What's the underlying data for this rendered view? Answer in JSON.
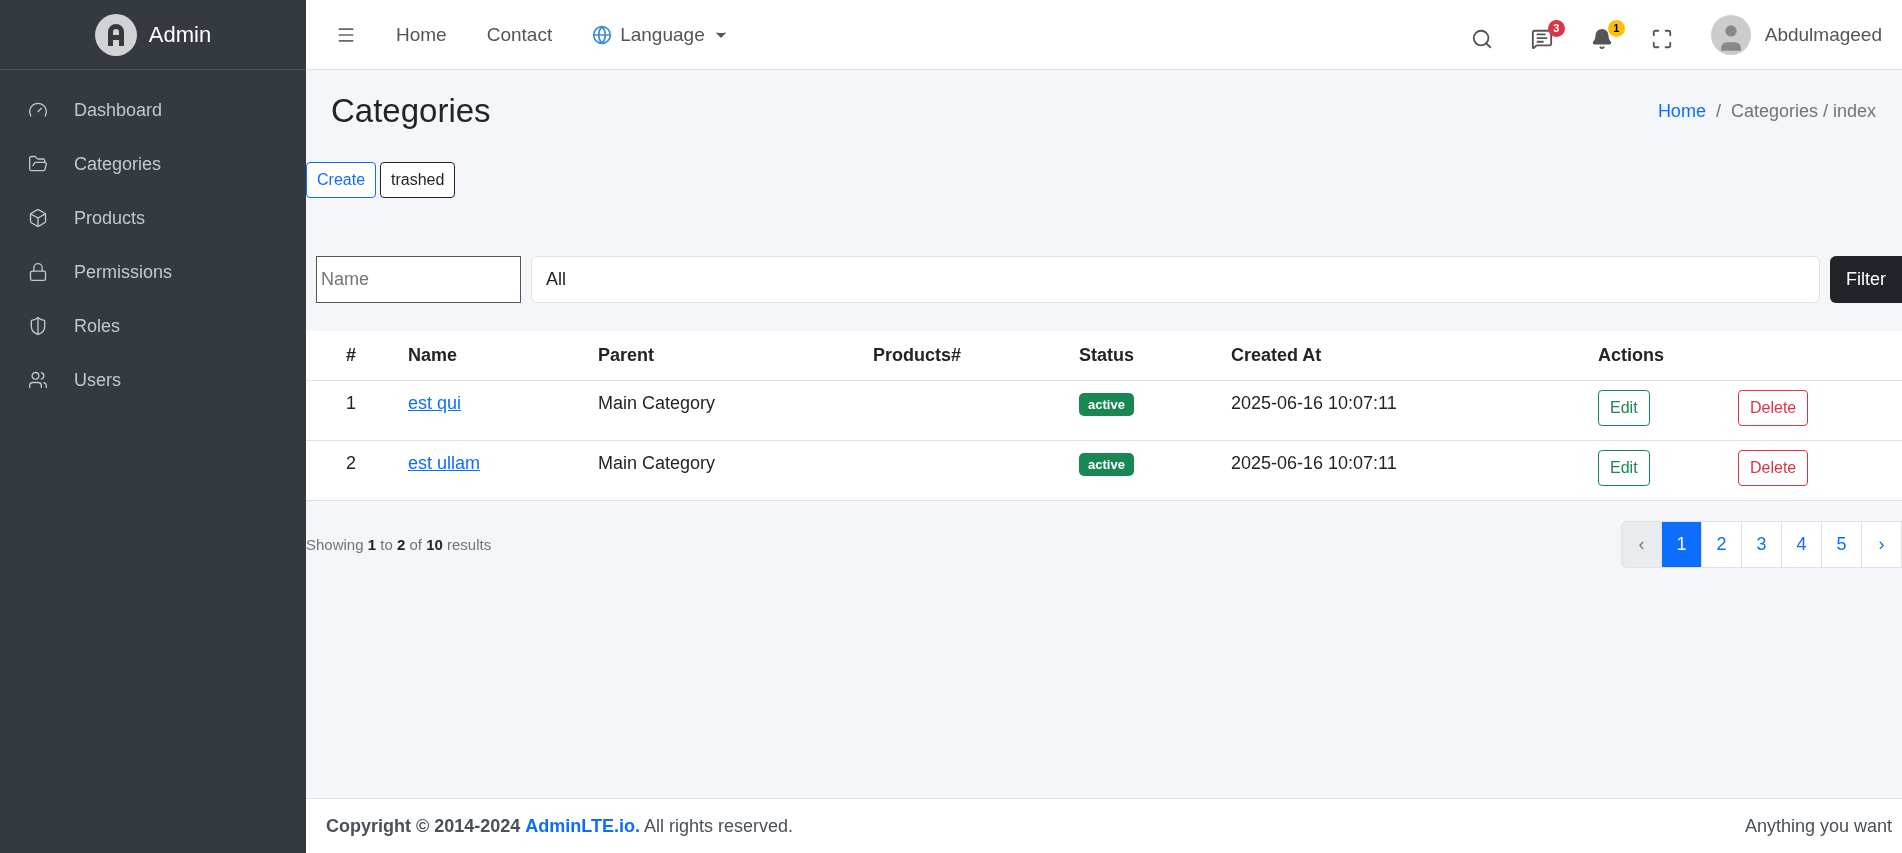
{
  "brand": {
    "name": "Admin"
  },
  "sidebar": {
    "items": [
      {
        "label": "Dashboard",
        "kind": "gauge",
        "selected": false
      },
      {
        "label": "Categories",
        "kind": "folder",
        "selected": false
      },
      {
        "label": "Products",
        "kind": "box",
        "selected": false
      },
      {
        "label": "Permissions",
        "kind": "lock",
        "selected": false
      },
      {
        "label": "Roles",
        "kind": "shield",
        "selected": false
      },
      {
        "label": "Users",
        "kind": "users",
        "selected": false
      }
    ]
  },
  "topbar": {
    "nav": [
      "Home",
      "Contact"
    ],
    "language": "Language",
    "messages_badge": "3",
    "notifications_badge": "1",
    "user": "Abdulmageed"
  },
  "page": {
    "title": "Categories",
    "breadcrumb": {
      "home": "Home",
      "separator": "/",
      "current": "Categories / index"
    }
  },
  "actions": [
    "Create",
    "trashed"
  ],
  "filter": {
    "name_placeholder": "Name",
    "status_value": "All",
    "button": "Filter"
  },
  "table": {
    "columns": [
      "#",
      "Name",
      "Parent",
      "Products#",
      "Status",
      "Created At",
      "Actions"
    ],
    "rows": [
      {
        "index": "1",
        "name": "est qui",
        "parent": "Main Category",
        "status": "active",
        "created": "2025-06-16 10:07:11",
        "edit": "Edit",
        "delete": "Delete"
      },
      {
        "index": "2",
        "name": "est ullam",
        "parent": "Main Category",
        "status": "active",
        "created": "2025-06-16 10:07:11",
        "edit": "Edit",
        "delete": "Delete"
      }
    ]
  },
  "summary": {
    "prefix": "Showing",
    "from": "1",
    "to_word": "to",
    "to": "2",
    "of_word": "of",
    "total": "10",
    "suffix": "results"
  },
  "pagination": {
    "prev": "‹",
    "next": "›",
    "pages": [
      {
        "label": "1",
        "selected": true
      },
      {
        "label": "2",
        "selected": false
      },
      {
        "label": "3",
        "selected": false
      },
      {
        "label": "4",
        "selected": false
      },
      {
        "label": "5",
        "selected": false
      }
    ]
  },
  "footer": {
    "copyright": "Copyright © 2014-2024",
    "link": "AdminLTE.io.",
    "rest": "All rights reserved.",
    "right": "Anything you want"
  }
}
